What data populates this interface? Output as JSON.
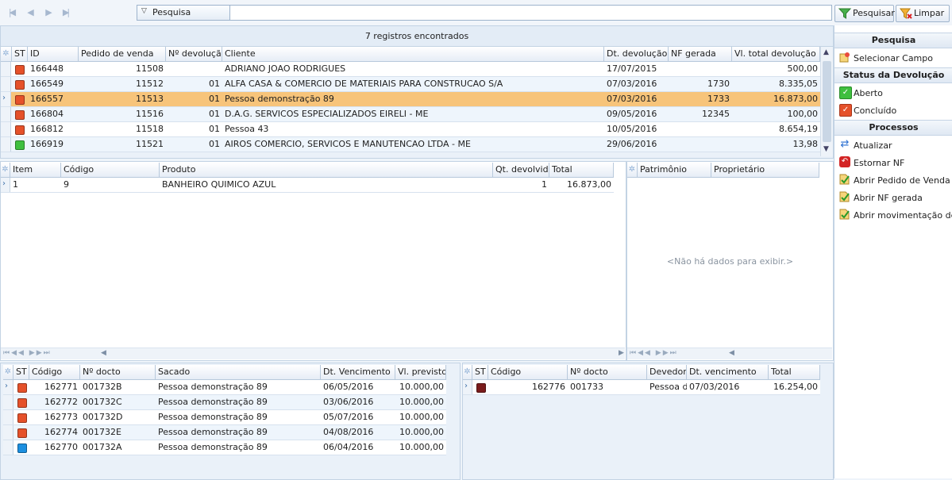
{
  "toolbar": {
    "search_label": "Pesquisa",
    "search_value": "",
    "pesquisar_label": "Pesquisar",
    "limpar_label": "Limpar"
  },
  "main": {
    "count_label": "7 registros encontrados",
    "columns": [
      "ST",
      "ID",
      "Pedido de venda",
      "Nº devolução",
      "Cliente",
      "Dt. devolução",
      "NF gerada",
      "Vl. total devolução"
    ],
    "rows": [
      {
        "status": "#e5512a",
        "id": "166448",
        "pedido": "11508",
        "devolucao": "",
        "cliente": "ADRIANO JOAO RODRIGUES",
        "dt": "17/07/2015",
        "nf": "",
        "total": "500,00"
      },
      {
        "status": "#e5512a",
        "id": "166549",
        "pedido": "11512",
        "devolucao": "01",
        "cliente": "ALFA CASA & COMERCIO DE MATERIAIS PARA CONSTRUCAO S/A",
        "dt": "07/03/2016",
        "nf": "1730",
        "total": "8.335,05"
      },
      {
        "status": "#e5512a",
        "id": "166557",
        "pedido": "11513",
        "devolucao": "01",
        "cliente": "Pessoa demonstração 89",
        "dt": "07/03/2016",
        "nf": "1733",
        "total": "16.873,00"
      },
      {
        "status": "#e5512a",
        "id": "166804",
        "pedido": "11516",
        "devolucao": "01",
        "cliente": "D.A.G. SERVICOS ESPECIALIZADOS EIRELI  - ME",
        "dt": "09/05/2016",
        "nf": "12345",
        "total": "100,00"
      },
      {
        "status": "#e5512a",
        "id": "166812",
        "pedido": "11518",
        "devolucao": "01",
        "cliente": "Pessoa 43",
        "dt": "10/05/2016",
        "nf": "",
        "total": "8.654,19"
      },
      {
        "status": "#3fbf3f",
        "id": "166919",
        "pedido": "11521",
        "devolucao": "01",
        "cliente": "AIROS COMERCIO, SERVICOS E MANUTENCAO LTDA - ME",
        "dt": "29/06/2016",
        "nf": "",
        "total": "13,98"
      }
    ]
  },
  "items": {
    "columns": [
      "Item",
      "Código",
      "Produto",
      "Qt. devolvida",
      "Total"
    ],
    "rows": [
      {
        "item": "1",
        "codigo": "9",
        "produto": "BANHEIRO QUIMICO AZUL",
        "qt": "1",
        "total": "16.873,00"
      }
    ]
  },
  "patrimonio": {
    "columns": [
      "Patrimônio",
      "Proprietário"
    ],
    "empty_text": "<Não há dados para exibir.>"
  },
  "titulos": {
    "columns": [
      "ST",
      "Código",
      "Nº docto",
      "Sacado",
      "Dt. Vencimento",
      "Vl. previsto"
    ],
    "rows": [
      {
        "status": "#e5512a",
        "codigo": "162771",
        "docto": "001732B",
        "sacado": "Pessoa demonstração 89",
        "venc": "06/05/2016",
        "valor": "10.000,00"
      },
      {
        "status": "#e5512a",
        "codigo": "162772",
        "docto": "001732C",
        "sacado": "Pessoa demonstração 89",
        "venc": "03/06/2016",
        "valor": "10.000,00"
      },
      {
        "status": "#e5512a",
        "codigo": "162773",
        "docto": "001732D",
        "sacado": "Pessoa demonstração 89",
        "venc": "05/07/2016",
        "valor": "10.000,00"
      },
      {
        "status": "#e5512a",
        "codigo": "162774",
        "docto": "001732E",
        "sacado": "Pessoa demonstração 89",
        "venc": "04/08/2016",
        "valor": "10.000,00"
      },
      {
        "status": "#1c8fe0",
        "codigo": "162770",
        "docto": "001732A",
        "sacado": "Pessoa demonstração 89",
        "venc": "06/04/2016",
        "valor": "10.000,00"
      }
    ]
  },
  "credito": {
    "columns": [
      "ST",
      "Código",
      "Nº docto",
      "Devedor",
      "Dt. vencimento",
      "Total"
    ],
    "rows": [
      {
        "status": "#7a1c1c",
        "codigo": "162776",
        "docto": "001733",
        "devedor": "Pessoa de",
        "venc": "07/03/2016",
        "total": "16.254,00"
      }
    ]
  },
  "side": {
    "pesquisa_title": "Pesquisa",
    "selecionar_campo": "Selecionar Campo",
    "status_title": "Status da Devolução",
    "aberto": "Aberto",
    "concluido": "Concluído",
    "processos_title": "Processos",
    "atualizar": "Atualizar",
    "estornar": "Estornar NF",
    "abrir_pedido": "Abrir Pedido de Venda",
    "abrir_nf": "Abrir NF gerada",
    "abrir_mov": "Abrir movimentação de..."
  },
  "colors": {
    "selected_row": "#f7c47a",
    "accent": "#3b6ea8"
  }
}
